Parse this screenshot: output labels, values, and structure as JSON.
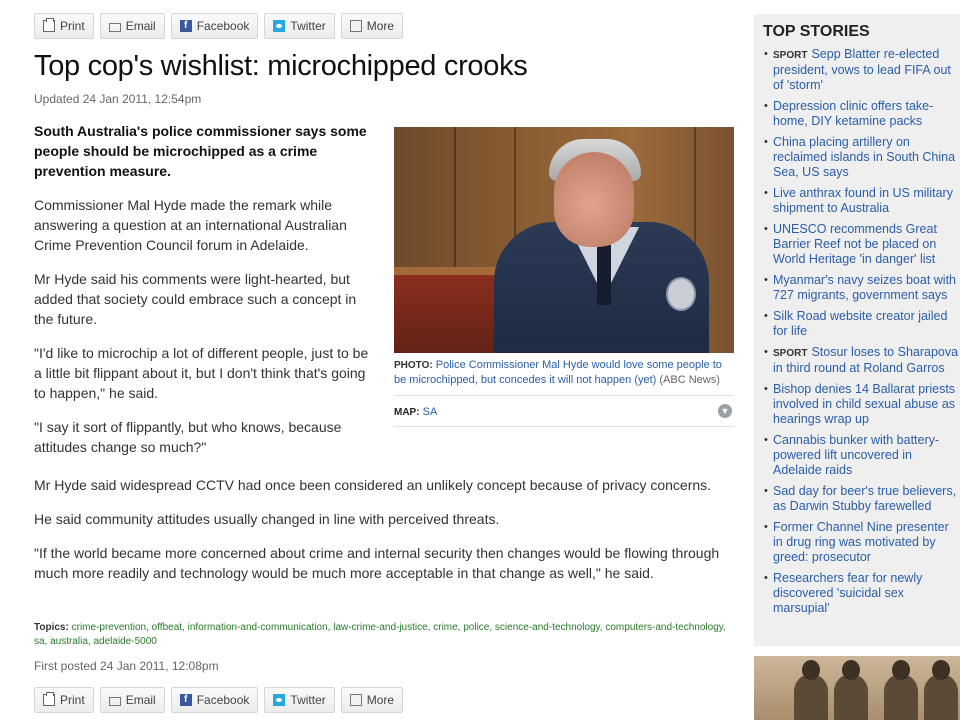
{
  "share": {
    "print": "Print",
    "email": "Email",
    "facebook": "Facebook",
    "twitter": "Twitter",
    "more": "More"
  },
  "article": {
    "title": "Top cop's wishlist: microchipped crooks",
    "updated": "Updated 24 Jan 2011, 12:54pm",
    "lead": "South Australia's police commissioner says some people should be microchipped as a crime prevention measure.",
    "paragraphs_narrow": [
      "Commissioner Mal Hyde made the remark while answering a question at an international Australian Crime Prevention Council forum in Adelaide.",
      "Mr Hyde said his comments were light-hearted, but added that society could embrace such a concept in the future.",
      "\"I'd like to microchip a lot of different people, just to be a little bit flippant about it, but I don't think that's going to happen,\" he said.",
      "\"I say it sort of flippantly, but who knows, because attitudes change so much?\""
    ],
    "paragraphs_wide": [
      "Mr Hyde said widespread CCTV had once been considered an unlikely concept because of privacy concerns.",
      "He said community attitudes usually changed in line with perceived threats.",
      "\"If the world became more concerned about crime and internal security then changes would be flowing through much more readily and technology would be much more acceptable in that change as well,\" he said."
    ],
    "photo": {
      "label": "PHOTO:",
      "caption": "Police Commissioner Mal Hyde would love some people to be microchipped, but concedes it will not happen (yet)",
      "source": "(ABC News)"
    },
    "map": {
      "label": "MAP:",
      "value": "SA"
    },
    "topics_label": "Topics:",
    "topics": "crime-prevention, offbeat, information-and-communication, law-crime-and-justice, crime, police, science-and-technology, computers-and-technology, sa, australia, adelaide-5000",
    "first_posted": "First posted 24 Jan 2011, 12:08pm"
  },
  "sidebar": {
    "title": "TOP STORIES",
    "stories": [
      {
        "tag": "SPORT",
        "text": "Sepp Blatter re-elected president, vows to lead FIFA out of 'storm'"
      },
      {
        "tag": "",
        "text": "Depression clinic offers take-home, DIY ketamine packs"
      },
      {
        "tag": "",
        "text": "China placing artillery on reclaimed islands in South China Sea, US says"
      },
      {
        "tag": "",
        "text": "Live anthrax found in US military shipment to Australia"
      },
      {
        "tag": "",
        "text": "UNESCO recommends Great Barrier Reef not be placed on World Heritage 'in danger' list"
      },
      {
        "tag": "",
        "text": "Myanmar's navy seizes boat with 727 migrants, government says"
      },
      {
        "tag": "",
        "text": "Silk Road website creator jailed for life"
      },
      {
        "tag": "SPORT",
        "text": "Stosur loses to Sharapova in third round at Roland Garros"
      },
      {
        "tag": "",
        "text": "Bishop denies 14 Ballarat priests involved in child sexual abuse as hearings wrap up"
      },
      {
        "tag": "",
        "text": "Cannabis bunker with battery-powered lift uncovered in Adelaide raids"
      },
      {
        "tag": "",
        "text": "Sad day for beer's true believers, as Darwin Stubby farewelled"
      },
      {
        "tag": "",
        "text": "Former Channel Nine presenter in drug ring was motivated by greed: prosecutor"
      },
      {
        "tag": "",
        "text": "Researchers fear for newly discovered 'suicidal sex marsupial'"
      }
    ]
  }
}
